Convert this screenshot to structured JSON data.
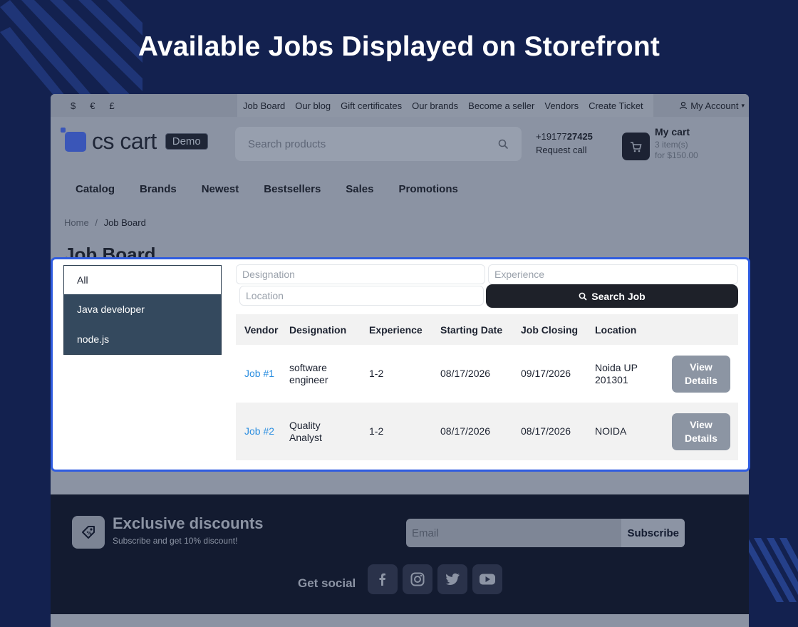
{
  "hero": {
    "title": "Available Jobs Displayed on Storefront"
  },
  "topbar": {
    "currencies": [
      "$",
      "€",
      "£"
    ],
    "links": [
      "Job Board",
      "Our blog",
      "Gift certificates",
      "Our brands",
      "Become a seller",
      "Vendors",
      "Create Ticket"
    ],
    "account": "My Account"
  },
  "header": {
    "logo_text": "cs cart",
    "demo_badge": "Demo",
    "search_placeholder": "Search products",
    "phone_prefix": "+19177",
    "phone_bold": "27425",
    "request_call": "Request call",
    "cart_title": "My cart",
    "cart_items": "3 item(s)",
    "cart_total": "for $150.00"
  },
  "mainnav": [
    "Catalog",
    "Brands",
    "Newest",
    "Bestsellers",
    "Sales",
    "Promotions"
  ],
  "breadcrumb": {
    "home": "Home",
    "sep": "/",
    "current": "Job Board"
  },
  "page_title": "Job Board",
  "categories": [
    "All",
    "Java developer",
    "node.js"
  ],
  "filters": {
    "designation_placeholder": "Designation",
    "experience_placeholder": "Experience",
    "location_placeholder": "Location",
    "search_button": "Search Job"
  },
  "table": {
    "headers": [
      "Vendor",
      "Designation",
      "Experience",
      "Starting Date",
      "Job Closing",
      "Location"
    ],
    "rows": [
      {
        "vendor": "Job #1",
        "designation_1": "software",
        "designation_2": "engineer",
        "experience": "1-2",
        "start": "08/17/2026",
        "closing": "09/17/2026",
        "location_1": "Noida UP",
        "location_2": "201301",
        "btn_1": "View",
        "btn_2": "Details"
      },
      {
        "vendor": "Job #2",
        "designation_1": "Quality",
        "designation_2": "Analyst",
        "experience": "1-2",
        "start": "08/17/2026",
        "closing": "08/17/2026",
        "location_1": "NOIDA",
        "location_2": "",
        "btn_1": "View",
        "btn_2": "Details"
      }
    ]
  },
  "footer": {
    "discount_title": "Exclusive discounts",
    "discount_sub": "Subscribe and get 10% discount!",
    "email_placeholder": "Email",
    "subscribe": "Subscribe",
    "social_label": "Get social"
  },
  "colors": {
    "background": "#13214f",
    "highlight_border": "#2f5ce0",
    "link": "#2d8fe0",
    "category_dark": "#34495e"
  },
  "icons": [
    "search-icon",
    "cart-icon",
    "user-icon",
    "tag-icon",
    "facebook-icon",
    "instagram-icon",
    "twitter-icon",
    "youtube-icon"
  ]
}
